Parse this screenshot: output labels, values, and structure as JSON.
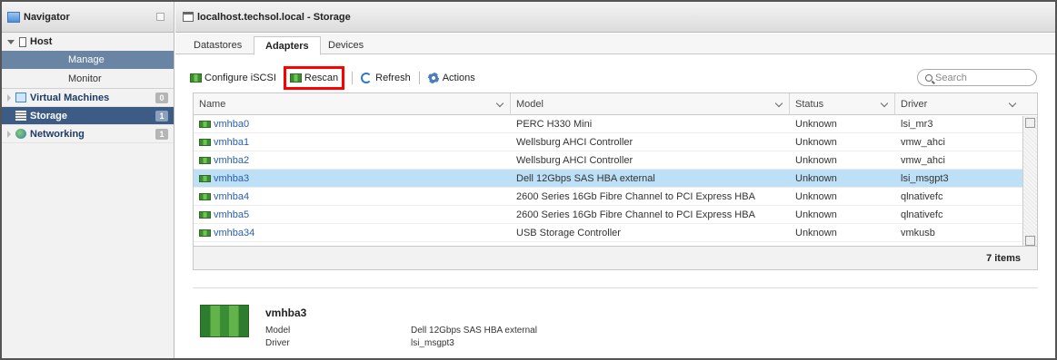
{
  "navigator": {
    "title": "Navigator",
    "host": {
      "label": "Host",
      "manage": "Manage",
      "monitor": "Monitor"
    },
    "items": [
      {
        "label": "Virtual Machines",
        "count": "0"
      },
      {
        "label": "Storage",
        "count": "1"
      },
      {
        "label": "Networking",
        "count": "1"
      }
    ]
  },
  "main": {
    "title": "localhost.techsol.local - Storage",
    "tabs": [
      "Datastores",
      "Adapters",
      "Devices"
    ],
    "toolbar": {
      "configure_iscsi": "Configure iSCSI",
      "rescan": "Rescan",
      "refresh": "Refresh",
      "actions": "Actions"
    },
    "search_placeholder": "Search",
    "table": {
      "columns": [
        "Name",
        "Model",
        "Status",
        "Driver"
      ],
      "rows": [
        {
          "name": "vmhba0",
          "model": "PERC H330 Mini",
          "status": "Unknown",
          "driver": "lsi_mr3"
        },
        {
          "name": "vmhba1",
          "model": "Wellsburg AHCI Controller",
          "status": "Unknown",
          "driver": "vmw_ahci"
        },
        {
          "name": "vmhba2",
          "model": "Wellsburg AHCI Controller",
          "status": "Unknown",
          "driver": "vmw_ahci"
        },
        {
          "name": "vmhba3",
          "model": "Dell 12Gbps SAS HBA external",
          "status": "Unknown",
          "driver": "lsi_msgpt3"
        },
        {
          "name": "vmhba4",
          "model": "2600 Series 16Gb Fibre Channel to PCI Express HBA",
          "status": "Unknown",
          "driver": "qlnativefc"
        },
        {
          "name": "vmhba5",
          "model": "2600 Series 16Gb Fibre Channel to PCI Express HBA",
          "status": "Unknown",
          "driver": "qlnativefc"
        },
        {
          "name": "vmhba34",
          "model": "USB Storage Controller",
          "status": "Unknown",
          "driver": "vmkusb"
        }
      ],
      "item_count": "7 items"
    },
    "details": {
      "title": "vmhba3",
      "model_label": "Model",
      "model_value": "Dell 12Gbps SAS HBA external",
      "driver_label": "Driver",
      "driver_value": "lsi_msgpt3"
    }
  },
  "colors": {
    "selected_row": "#bde0f7",
    "nav_selected": "#3c5c85",
    "highlight_box": "#ff0000"
  }
}
